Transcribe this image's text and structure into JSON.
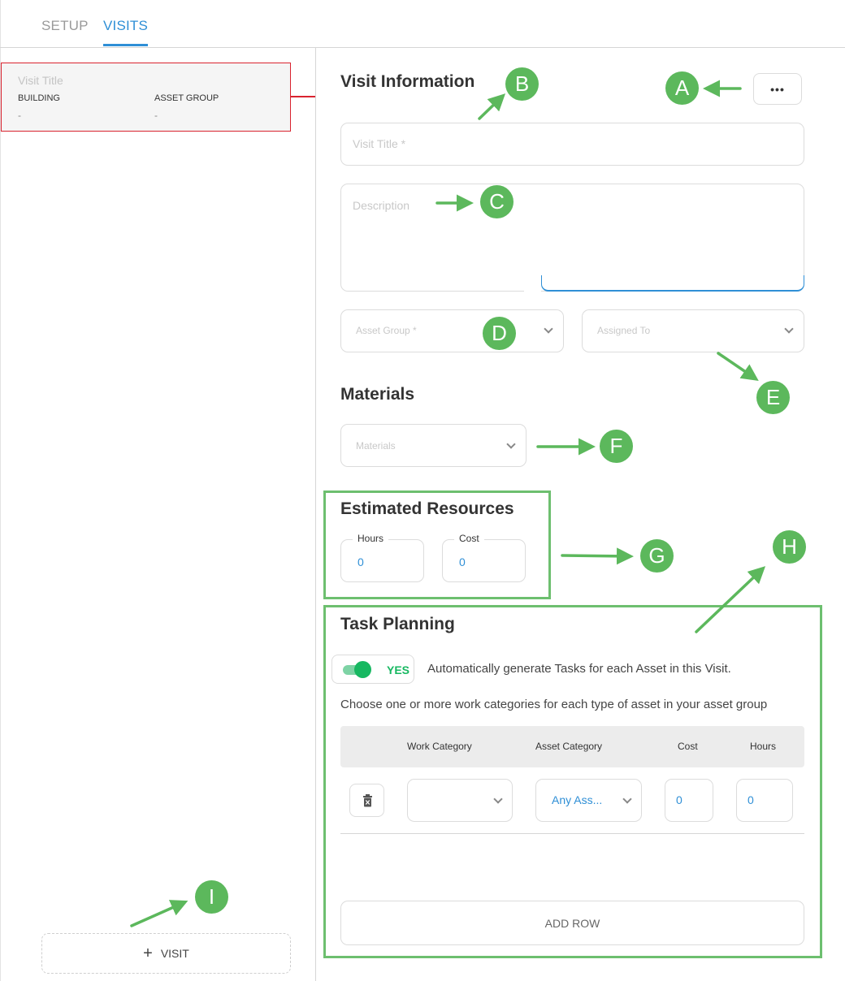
{
  "tabs": [
    {
      "label": "SETUP",
      "active": false
    },
    {
      "label": "VISITS",
      "active": true
    }
  ],
  "colors": {
    "accent": "#2f8fd6",
    "selection": "#d9232f",
    "annotation": "#5cb85c",
    "toggle_on": "#17b861"
  },
  "visit_card": {
    "title_placeholder": "Visit Title",
    "building_label": "BUILDING",
    "building_value": "-",
    "asset_group_label": "ASSET GROUP",
    "asset_group_value": "-"
  },
  "add_visit": {
    "icon": "plus-icon",
    "icon_glyph": "+",
    "label": "VISIT"
  },
  "visit_information": {
    "heading": "Visit Information",
    "more_button": "•••",
    "visit_title_placeholder": "Visit Title *",
    "description_placeholder": "Description",
    "asset_group_placeholder": "Asset Group *",
    "assigned_to_placeholder": "Assigned To"
  },
  "materials": {
    "heading": "Materials",
    "placeholder": "Materials"
  },
  "estimated_resources": {
    "heading": "Estimated Resources",
    "hours_label": "Hours",
    "hours_value": "0",
    "cost_label": "Cost",
    "cost_value": "0"
  },
  "task_planning": {
    "heading": "Task Planning",
    "toggle_label": "YES",
    "toggle_on": true,
    "auto_generate_text": "Automatically generate Tasks for each Asset in this Visit.",
    "instruction_text": "Choose one or more work categories for each type of asset in your asset group",
    "columns": [
      "Work Category",
      "Asset Category",
      "Cost",
      "Hours"
    ],
    "rows": [
      {
        "work_category": "",
        "asset_category": "Any Ass...",
        "cost": "0",
        "hours": "0"
      }
    ],
    "add_row_label": "ADD ROW"
  },
  "annotations": [
    "A",
    "B",
    "C",
    "D",
    "E",
    "F",
    "G",
    "H",
    "I"
  ]
}
